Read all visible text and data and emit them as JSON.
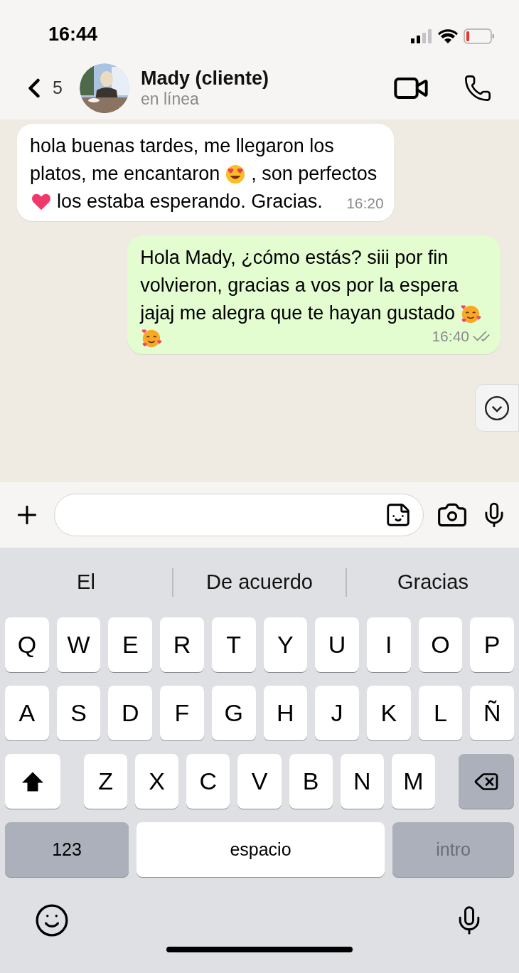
{
  "status_bar": {
    "time": "16:44"
  },
  "header": {
    "back_count": "5",
    "name": "Mady (cliente)",
    "status": "en línea"
  },
  "messages": [
    {
      "kind": "incoming",
      "time": "16:20",
      "lines": [
        [
          {
            "kind": "text",
            "text": "hola buenas tardes, me llegaron los"
          }
        ],
        [
          {
            "kind": "text",
            "text": "platos, me encantaron"
          },
          {
            "kind": "heart-eyes"
          },
          {
            "kind": "text",
            "text": ", son perfectos"
          }
        ],
        [
          {
            "kind": "heart"
          },
          {
            "kind": "text",
            "text": "los estaba esperando. Gracias."
          }
        ]
      ]
    },
    {
      "kind": "outgoing",
      "time": "16:40",
      "read": false,
      "lines": [
        [
          {
            "kind": "text",
            "text": "Hola Mady, ¿cómo estás? siii por fin"
          }
        ],
        [
          {
            "kind": "text",
            "text": "volvieron, gracias a vos por la espera"
          }
        ],
        [
          {
            "kind": "text",
            "text": "jajaj me alegra que te hayan gustado"
          },
          {
            "kind": "hearts-face"
          }
        ],
        [
          {
            "kind": "hearts-face"
          }
        ]
      ]
    }
  ],
  "suggestions": [
    "El",
    "De acuerdo",
    "Gracias"
  ],
  "keyboard": {
    "rows": [
      {
        "keys": [
          {
            "kind": "letter",
            "label": "Q"
          },
          {
            "kind": "letter",
            "label": "W"
          },
          {
            "kind": "letter",
            "label": "E"
          },
          {
            "kind": "letter",
            "label": "R"
          },
          {
            "kind": "letter",
            "label": "T"
          },
          {
            "kind": "letter",
            "label": "Y"
          },
          {
            "kind": "letter",
            "label": "U"
          },
          {
            "kind": "letter",
            "label": "I"
          },
          {
            "kind": "letter",
            "label": "O"
          },
          {
            "kind": "letter",
            "label": "P"
          }
        ]
      },
      {
        "keys": [
          {
            "kind": "letter",
            "label": "A"
          },
          {
            "kind": "letter",
            "label": "S"
          },
          {
            "kind": "letter",
            "label": "D"
          },
          {
            "kind": "letter",
            "label": "F"
          },
          {
            "kind": "letter",
            "label": "G"
          },
          {
            "kind": "letter",
            "label": "H"
          },
          {
            "kind": "letter",
            "label": "J"
          },
          {
            "kind": "letter",
            "label": "K"
          },
          {
            "kind": "letter",
            "label": "L"
          },
          {
            "kind": "letter",
            "label": "Ñ"
          }
        ]
      },
      {
        "keys": [
          {
            "kind": "shift"
          },
          {
            "kind": "letter",
            "label": "Z"
          },
          {
            "kind": "letter",
            "label": "X"
          },
          {
            "kind": "letter",
            "label": "C"
          },
          {
            "kind": "letter",
            "label": "V"
          },
          {
            "kind": "letter",
            "label": "B"
          },
          {
            "kind": "letter",
            "label": "N"
          },
          {
            "kind": "letter",
            "label": "M"
          },
          {
            "kind": "delete"
          }
        ]
      },
      {
        "keys": [
          {
            "kind": "mode",
            "label": "123"
          },
          {
            "kind": "space",
            "label": "espacio"
          },
          {
            "kind": "return",
            "label": "intro"
          }
        ]
      }
    ]
  }
}
